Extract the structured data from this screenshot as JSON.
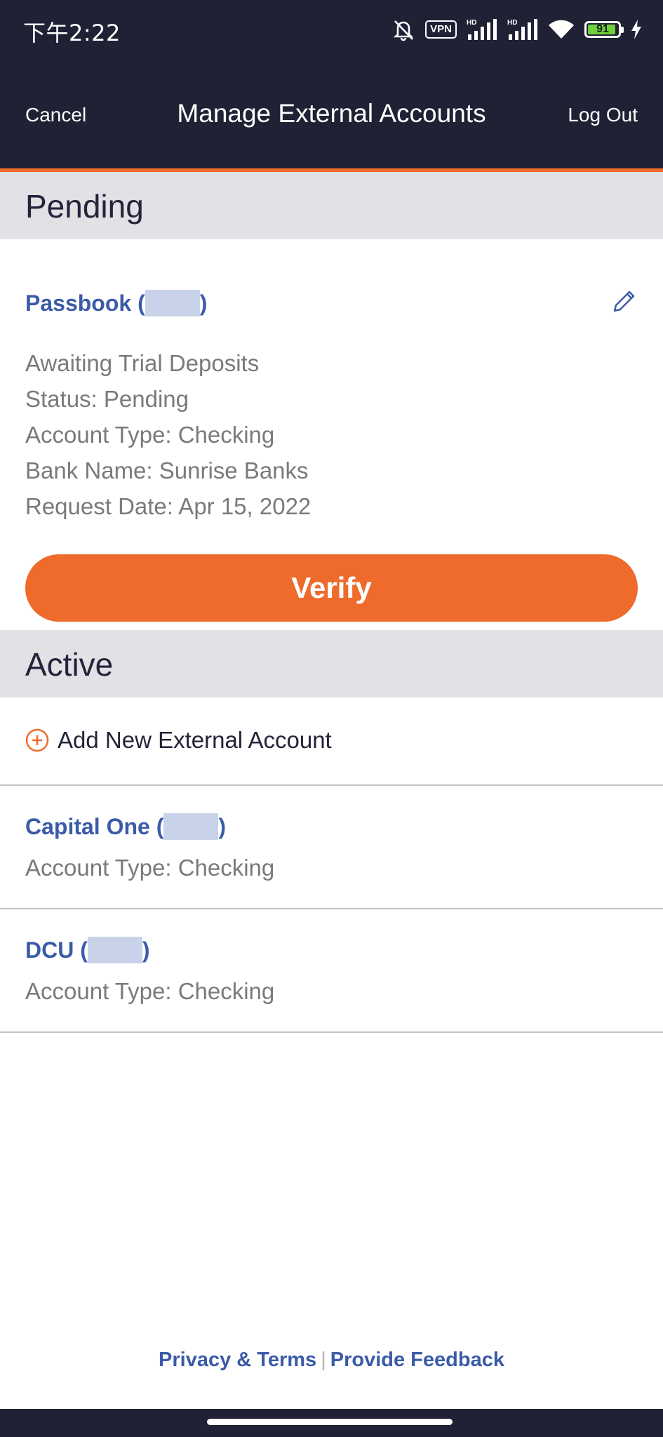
{
  "status_bar": {
    "time": "下午2:22",
    "vpn_label": "VPN",
    "signal_label": "HD",
    "battery_level": "91",
    "icons": [
      "bell-off-icon",
      "vpn-icon",
      "signal-hd-icon",
      "signal-hd-icon",
      "wifi-icon",
      "battery-icon",
      "charging-icon"
    ]
  },
  "nav": {
    "cancel_label": "Cancel",
    "title": "Manage External Accounts",
    "logout_label": "Log Out"
  },
  "pending": {
    "section_title": "Pending",
    "account_name_prefix": "Passbook (",
    "account_name_suffix": ")",
    "details": [
      "Awaiting Trial Deposits",
      "Status: Pending",
      "Account Type: Checking",
      "Bank Name: Sunrise Banks",
      "Request Date: Apr 15, 2022"
    ],
    "verify_label": "Verify",
    "edit_icon": "pencil-icon"
  },
  "active": {
    "section_title": "Active",
    "add_label": "Add New External Account",
    "add_icon": "plus-circle-icon",
    "accounts": [
      {
        "name_prefix": "Capital One (",
        "name_suffix": ")",
        "type": "Account Type: Checking"
      },
      {
        "name_prefix": "DCU (",
        "name_suffix": ")",
        "type": "Account Type: Checking"
      }
    ]
  },
  "footer": {
    "privacy_label": "Privacy & Terms",
    "separator": "|",
    "feedback_label": "Provide Feedback"
  },
  "colors": {
    "header_bg": "#202135",
    "accent": "#ee6b2b",
    "link": "#3b5ba8",
    "section_bg": "#e1e1e6",
    "muted_text": "#7a7a7a"
  }
}
